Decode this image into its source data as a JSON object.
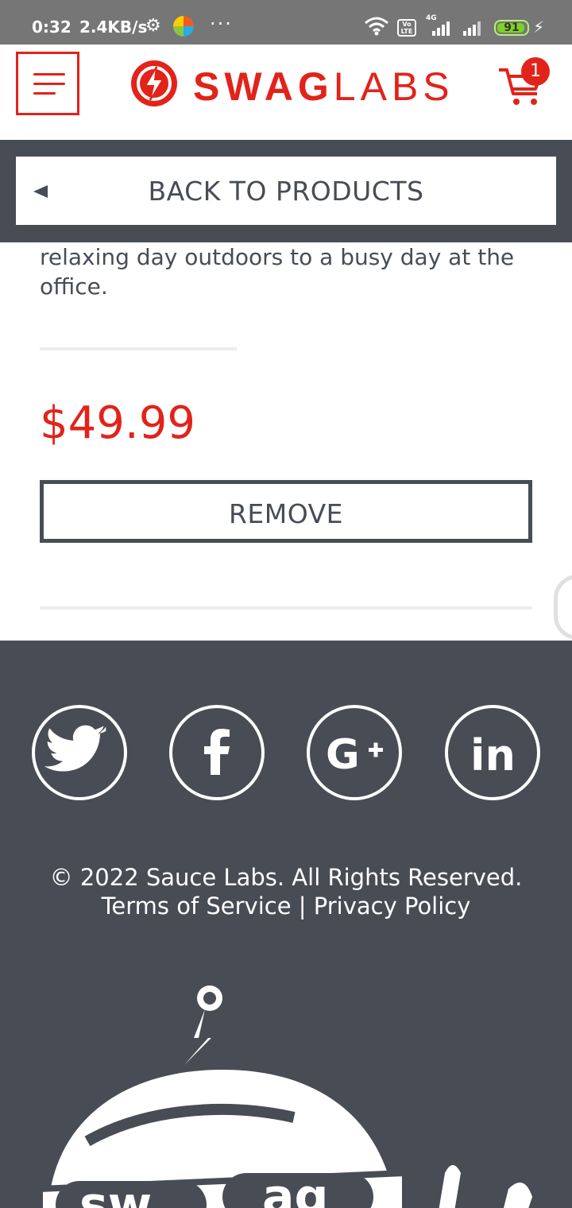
{
  "status_bar": {
    "time": "0:32",
    "speed": "2.4KB/s",
    "volte": "Vo LTE",
    "network": "4G",
    "battery": "91"
  },
  "header": {
    "logo_bold": "SWAG",
    "logo_light": "LABS",
    "cart_count": "1"
  },
  "back": {
    "label": "BACK TO PRODUCTS"
  },
  "product": {
    "description_visible": "relaxing day outdoors to a busy day at the office.",
    "price": "$49.99",
    "button_label": "REMOVE"
  },
  "footer": {
    "copyright": "© 2022 Sauce Labs. All Rights Reserved.",
    "links": "Terms of Service | Privacy Policy",
    "social": [
      "twitter-icon",
      "facebook-icon",
      "google-plus-icon",
      "linkedin-icon"
    ],
    "mascot_text": "swag"
  },
  "colors": {
    "brand_red": "#e2231a",
    "dark_gray": "#484c55",
    "status_bar": "#767676"
  }
}
